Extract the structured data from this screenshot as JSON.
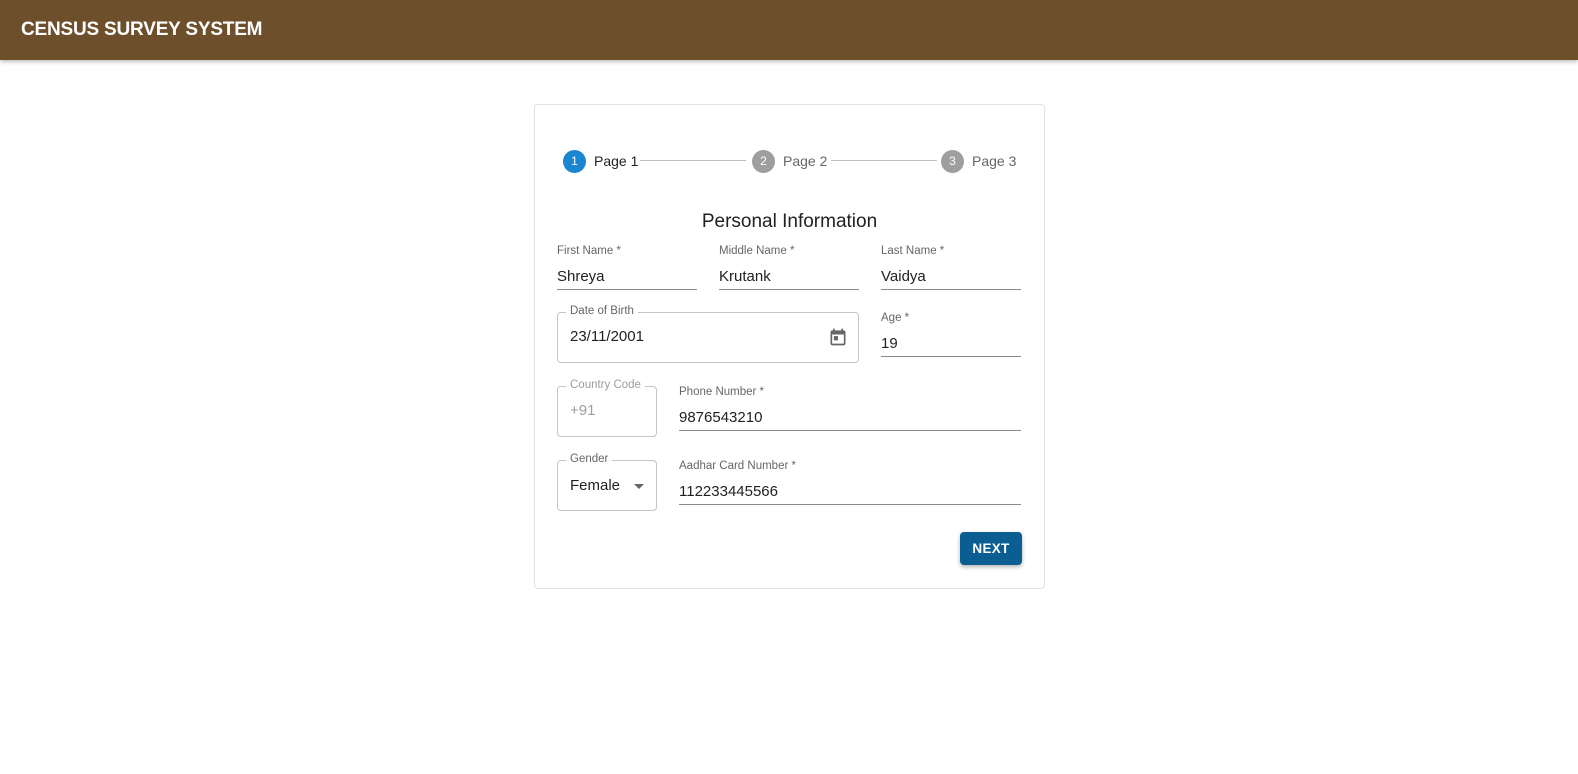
{
  "appbar": {
    "title": "CENSUS SURVEY SYSTEM",
    "color": "#6d4f2b"
  },
  "stepper": {
    "steps": [
      {
        "number": "1",
        "label": "Page 1",
        "active": true
      },
      {
        "number": "2",
        "label": "Page 2",
        "active": false
      },
      {
        "number": "3",
        "label": "Page 3",
        "active": false
      }
    ],
    "active_color": "#1a86d0"
  },
  "form": {
    "title": "Personal Information",
    "first_name": {
      "label": "First Name *",
      "value": "Shreya"
    },
    "middle_name": {
      "label": "Middle Name *",
      "value": "Krutank"
    },
    "last_name": {
      "label": "Last Name *",
      "value": "Vaidya"
    },
    "dob": {
      "label": "Date of Birth",
      "value": "23/11/2001",
      "icon": "calendar-icon"
    },
    "age": {
      "label": "Age *",
      "value": "19"
    },
    "country_code": {
      "label": "Country Code",
      "value": "+91"
    },
    "phone": {
      "label": "Phone Number *",
      "value": "9876543210"
    },
    "gender": {
      "label": "Gender",
      "value": "Female",
      "icon": "caret-down-icon"
    },
    "aadhar": {
      "label": "Aadhar Card Number *",
      "value": "112233445566"
    },
    "next_label": "NEXT",
    "button_color": "#0b5e91"
  }
}
